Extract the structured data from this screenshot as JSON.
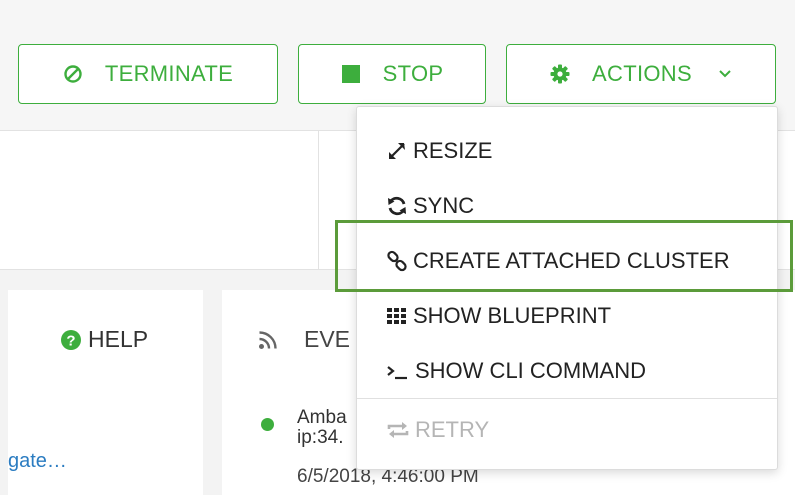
{
  "toolbar": {
    "terminate_label": "TERMINATE",
    "stop_label": "STOP",
    "actions_label": "ACTIONS"
  },
  "actions_menu": {
    "items": [
      {
        "label": "RESIZE",
        "icon": "resize-icon",
        "enabled": true
      },
      {
        "label": "SYNC",
        "icon": "sync-icon",
        "enabled": true
      },
      {
        "label": "CREATE ATTACHED CLUSTER",
        "icon": "link-icon",
        "enabled": true,
        "highlighted": true
      },
      {
        "label": "SHOW BLUEPRINT",
        "icon": "grid-icon",
        "enabled": true
      },
      {
        "label": "SHOW CLI COMMAND",
        "icon": "terminal-icon",
        "enabled": true
      },
      {
        "label": "RETRY",
        "icon": "retry-icon",
        "enabled": false
      }
    ]
  },
  "help": {
    "title": "HELP",
    "link_text": "gate…"
  },
  "events": {
    "title": "EVE",
    "entries": [
      {
        "line1": "Amba",
        "line2": "ip:34.",
        "time": "6/5/2018, 4:46:00 PM"
      }
    ]
  },
  "colors": {
    "accent": "#3dae3d",
    "highlight_border": "#5b9b3a",
    "link": "#2b7cc1",
    "disabled": "#b5b5b5"
  }
}
